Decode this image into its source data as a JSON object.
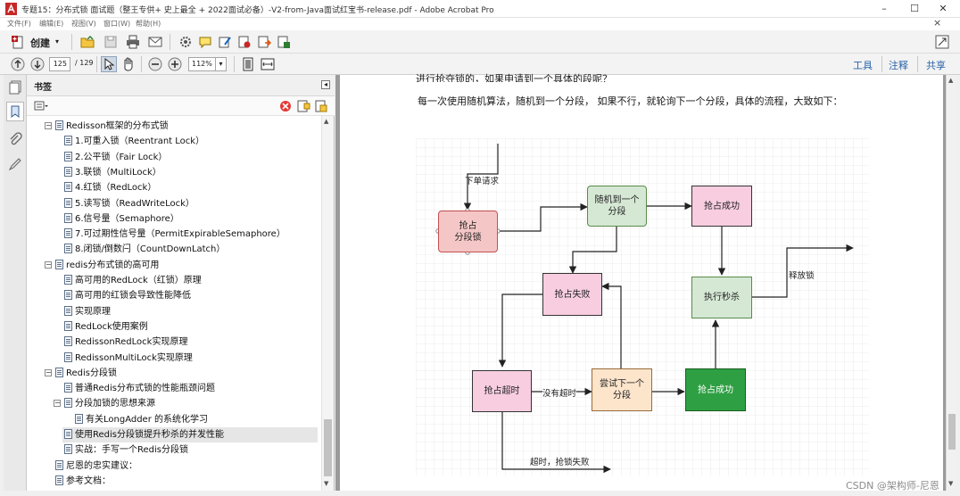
{
  "window": {
    "title": "专题15：分布式锁 面试题（整王专供+ 史上最全 + 2022面试必备）-V2-from-Java面试红宝书-release.pdf - Adobe Acrobat Pro",
    "minimize": "–",
    "maximize": "☐",
    "close": "✕",
    "doc_close": "×"
  },
  "menu": [
    "文件(F)",
    "编辑(E)",
    "视图(V)",
    "窗口(W)",
    "帮助(H)"
  ],
  "toolbar": {
    "create_label": "创建",
    "page_current": "125",
    "page_total": "/ 129",
    "zoom": "112%",
    "tools_link": "工具",
    "comment_link": "注释",
    "share_link": "共享"
  },
  "bookmarks_panel": {
    "title": "书签",
    "items": [
      {
        "text": "Redisson框架的分布式锁",
        "level": 1,
        "toggle": "−"
      },
      {
        "text": "1.可重入锁（Reentrant Lock）",
        "level": 2
      },
      {
        "text": "2.公平锁（Fair Lock）",
        "level": 2
      },
      {
        "text": "3.联锁（MultiLock）",
        "level": 2
      },
      {
        "text": "4.红锁（RedLock）",
        "level": 2
      },
      {
        "text": "5.读写锁（ReadWriteLock）",
        "level": 2
      },
      {
        "text": "6.信号量（Semaphore）",
        "level": 2
      },
      {
        "text": "7.可过期性信号量（PermitExpirableSemaphore）",
        "level": 2
      },
      {
        "text": "8.闭锁/倒数闩（CountDownLatch）",
        "level": 2
      },
      {
        "text": "redis分布式锁的高可用",
        "level": 1,
        "toggle": "−"
      },
      {
        "text": "高可用的RedLock（红锁）原理",
        "level": 2
      },
      {
        "text": "高可用的红锁会导致性能降低",
        "level": 2
      },
      {
        "text": "实现原理",
        "level": 2
      },
      {
        "text": "RedLock使用案例",
        "level": 2
      },
      {
        "text": "RedissonRedLock实现原理",
        "level": 2
      },
      {
        "text": "RedissonMultiLock实现原理",
        "level": 2
      },
      {
        "text": "Redis分段锁",
        "level": 1,
        "toggle": "−"
      },
      {
        "text": "普通Redis分布式锁的性能瓶颈问题",
        "level": 2
      },
      {
        "text": "分段加锁的思想来源",
        "level": 2,
        "toggle": "−"
      },
      {
        "text": "有关LongAdder 的系统化学习",
        "level": 3
      },
      {
        "text": "使用Redis分段锁提升秒杀的并发性能",
        "level": 2,
        "selected": true
      },
      {
        "text": "实战：手写一个Redis分段锁",
        "level": 2
      },
      {
        "text": "尼恩的忠实建议：",
        "level": 1
      },
      {
        "text": "参考文档：",
        "level": 1
      }
    ]
  },
  "document": {
    "top_text": "进行抢夺锁的，如果申请到一个具体的段呢？",
    "paragraph": "每一次使用随机算法，随机到一个分段， 如果不行，就轮询下一个分段，具体的流程，大致如下：",
    "diagram": {
      "nodes": {
        "grab_segment": "抢占\n分段锁",
        "random_segment": "随机到一个\n分段",
        "grab_success_1": "抢占成功",
        "grab_fail": "抢占失败",
        "execute_seckill": "执行秒杀",
        "grab_timeout": "抢占超时",
        "try_next": "尝试下一个\n分段",
        "grab_success_2": "抢占成功"
      },
      "labels": {
        "order_request": "下单请求",
        "release_lock": "释放锁",
        "no_timeout": "没有超时",
        "timeout_fail": "超时，抢锁失败"
      },
      "colors": {
        "pink_red": "#f5c6c6",
        "green_light": "#d5e8d4",
        "pink": "#f8cde0",
        "peach": "#fde5cc",
        "green_dark": "#2ea043"
      }
    }
  },
  "watermark": "CSDN @架构师-尼恩"
}
